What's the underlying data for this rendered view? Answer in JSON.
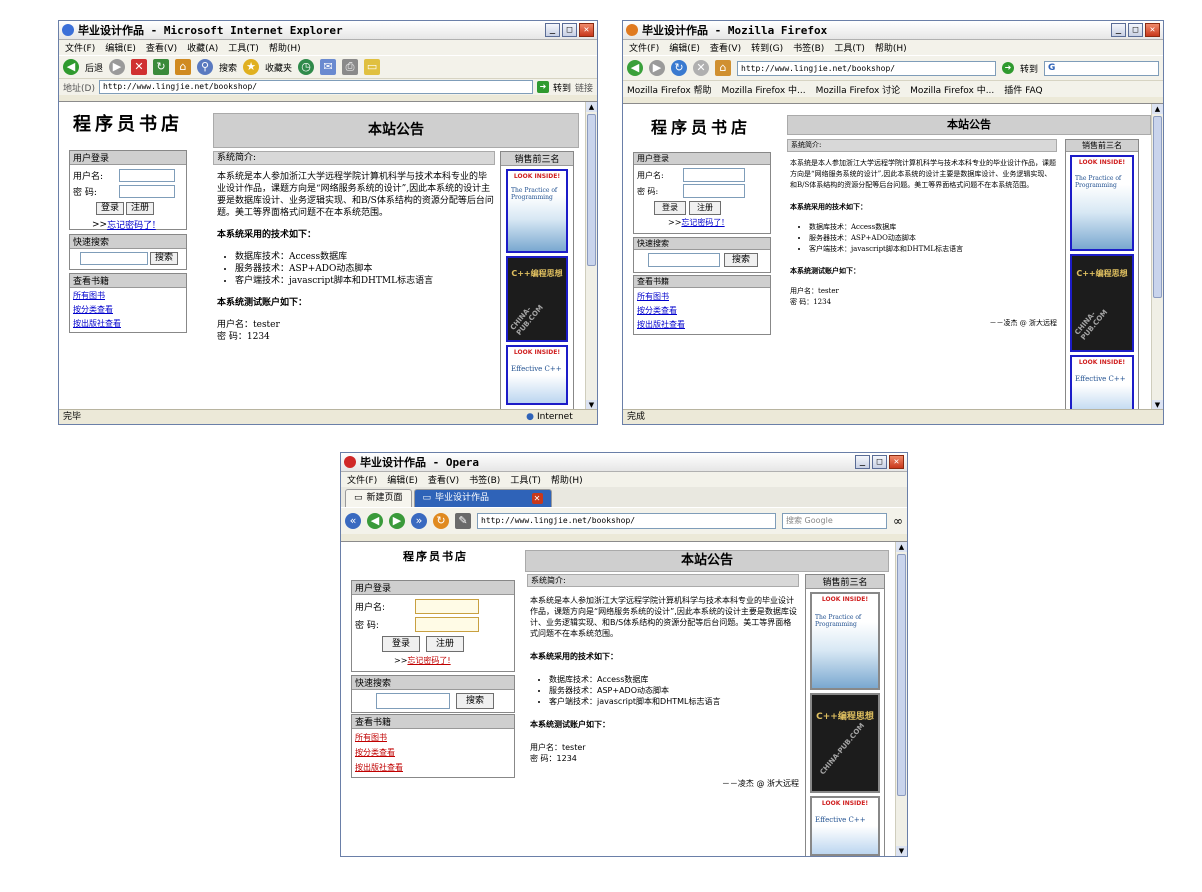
{
  "site": {
    "logo": "程序员书店",
    "banner": "本站公告",
    "login": {
      "title": "用户登录",
      "ie_title": "用户登录",
      "user_label": "用户名:",
      "pass_label": "密 码:",
      "login_btn": "登录",
      "register_btn": "注册",
      "forgot": "忘记密码了!",
      "forgot_prefix": ">>"
    },
    "search": {
      "title": "快速搜索",
      "button": "搜索"
    },
    "browse": {
      "title": "查看书籍",
      "links": [
        "所有图书",
        "按分类查看",
        "按出版社查看"
      ]
    },
    "intro": {
      "heading": "系统简介:",
      "text": "本系统是本人参加浙江大学远程学院计算机科学与技术本科专业的毕业设计作品，课题方向是“网络服务系统的设计”,因此本系统的设计主要是数据库设计、业务逻辑实现、和B/S体系结构的资源分配等后台问题。美工等界面格式问题不在本系统范围。",
      "tech_heading": "本系统采用的技术如下：",
      "tech": [
        "数据库技术：Access数据库",
        "服务器技术：ASP+ADO动态脚本",
        "客户端技术：javascript脚本和DHTML标志语言"
      ],
      "account_heading": "本系统测试账户如下：",
      "account_user": "用户名：tester",
      "account_pass": "密 码：1234",
      "signature": "－－凌杰 @ 浙大远程"
    },
    "top3": {
      "title": "销售前三名",
      "books": [
        {
          "top": "LOOK INSIDE!",
          "title": "The Practice of Programming"
        },
        {
          "top": "C++编程思想",
          "title": "",
          "watermark": "CHINA-PUB.COM"
        },
        {
          "top": "LOOK INSIDE!",
          "title": "Effective C++"
        }
      ]
    }
  },
  "ie": {
    "title": "毕业设计作品 - Microsoft Internet Explorer",
    "menu": [
      "文件(F)",
      "编辑(E)",
      "查看(V)",
      "收藏(A)",
      "工具(T)",
      "帮助(H)"
    ],
    "toolbar": [
      "后退",
      "搜索",
      "收藏夹"
    ],
    "address_label": "地址(D)",
    "url": "http://www.lingjie.net/bookshop/",
    "go": "转到",
    "links": "链接",
    "status": "完毕",
    "zone": "Internet"
  },
  "ff": {
    "title": "毕业设计作品 - Mozilla Firefox",
    "menu": [
      "文件(F)",
      "编辑(E)",
      "查看(V)",
      "转到(G)",
      "书签(B)",
      "工具(T)",
      "帮助(H)"
    ],
    "url": "http://www.lingjie.net/bookshop/",
    "go": "转到",
    "search_letter": "G",
    "bookmarks": [
      "Mozilla Firefox 帮助",
      "Mozilla Firefox 中...",
      "Mozilla Firefox 讨论",
      "Mozilla Firefox 中...",
      "插件 FAQ"
    ],
    "status": "完成"
  },
  "opera": {
    "title": "毕业设计作品 - Opera",
    "menu": [
      "文件(F)",
      "编辑(E)",
      "查看(V)",
      "书签(B)",
      "工具(T)",
      "帮助(H)"
    ],
    "tabs": [
      "新建页面",
      "毕业设计作品"
    ],
    "url": "http://www.lingjie.net/bookshop/",
    "search_placeholder": "搜索 Google"
  },
  "colors": {
    "link": "#0000cc",
    "header_gray": "#cfcfcf",
    "title_blue": "#2f63b8"
  }
}
